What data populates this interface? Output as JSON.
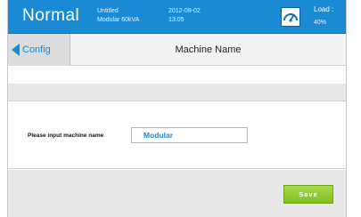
{
  "header": {
    "mode": "Normal",
    "model_name": "Untitled",
    "model_spec": "Modular 60kVA",
    "date": "2012-09-02",
    "time": "13:05",
    "load_label": "Load :",
    "load_value": "40%",
    "load_icon": "load-gauge-icon",
    "background_color": "#1a8ad4"
  },
  "nav": {
    "back_label": "Config",
    "back_icon": "back-arrow-icon",
    "title": "Machine Name"
  },
  "form": {
    "field_label": "Please input machine name",
    "machine_name_value": "Modular"
  },
  "actions": {
    "save_label": "Save",
    "save_color": "#8cc63f"
  }
}
